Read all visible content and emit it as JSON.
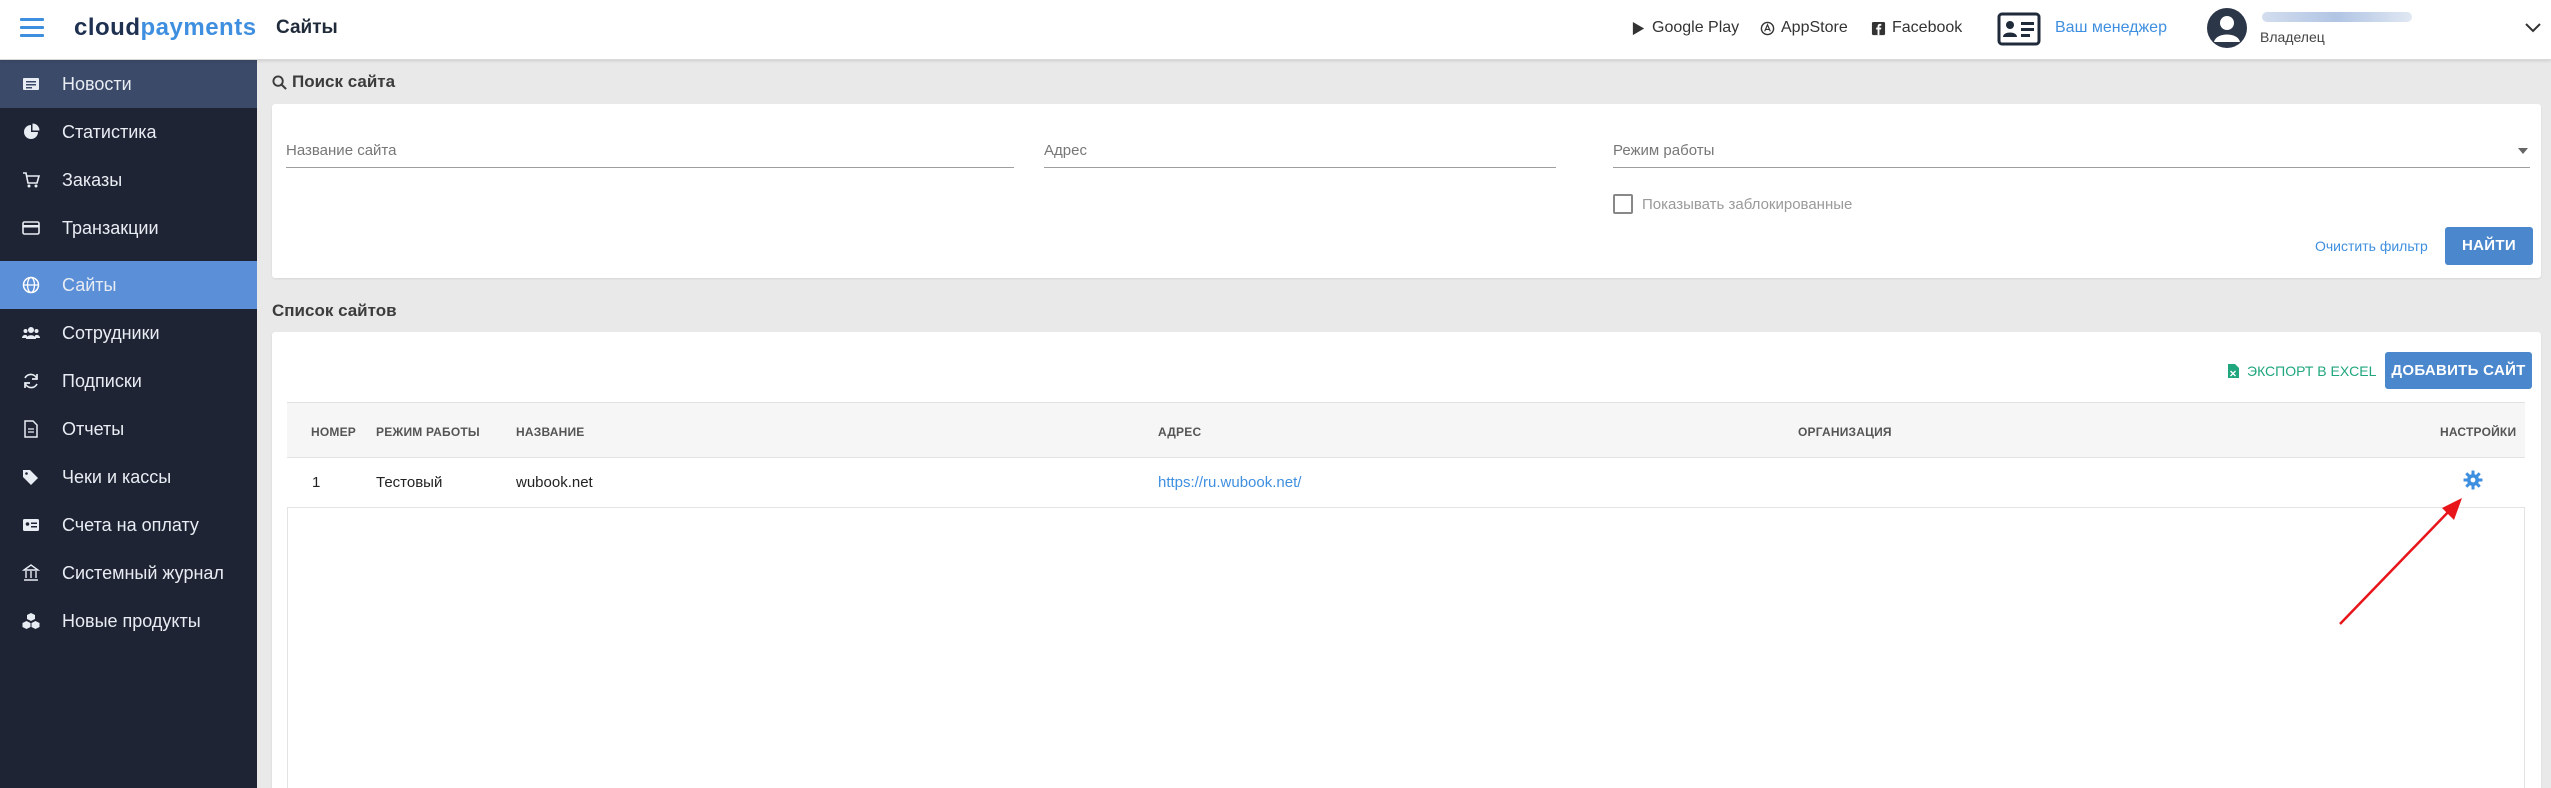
{
  "header": {
    "logo_part1": "cloud",
    "logo_part2": "payments",
    "title": "Сайты",
    "links": {
      "google_play": "Google Play",
      "app_store": "AppStore",
      "facebook": "Facebook"
    },
    "manager": "Ваш менеджер",
    "user_role": "Владелец"
  },
  "sidebar": {
    "items": [
      {
        "label": "Новости",
        "icon": "news-icon"
      },
      {
        "label": "Статистика",
        "icon": "pie-chart-icon"
      },
      {
        "label": "Заказы",
        "icon": "cart-icon"
      },
      {
        "label": "Транзакции",
        "icon": "card-icon"
      },
      {
        "label": "Сайты",
        "icon": "globe-icon"
      },
      {
        "label": "Сотрудники",
        "icon": "users-icon"
      },
      {
        "label": "Подписки",
        "icon": "refresh-icon"
      },
      {
        "label": "Отчеты",
        "icon": "document-icon"
      },
      {
        "label": "Чеки и кассы",
        "icon": "tags-icon"
      },
      {
        "label": "Счета на оплату",
        "icon": "id-card-icon"
      },
      {
        "label": "Системный журнал",
        "icon": "bank-icon"
      },
      {
        "label": "Новые продукты",
        "icon": "cubes-icon"
      }
    ]
  },
  "search": {
    "section_title": "Поиск сайта",
    "name_placeholder": "Название сайта",
    "address_placeholder": "Адрес",
    "mode_placeholder": "Режим работы",
    "show_blocked_label": "Показывать заблокированные",
    "clear_label": "Очистить фильтр",
    "find_label": "НАЙТИ"
  },
  "list": {
    "section_title": "Список сайтов",
    "export_label": "ЭКСПОРТ В EXCEL",
    "add_label": "ДОБАВИТЬ САЙТ",
    "columns": [
      "НОМЕР",
      "РЕЖИМ РАБОТЫ",
      "НАЗВАНИЕ",
      "АДРЕС",
      "ОРГАНИЗАЦИЯ",
      "НАСТРОЙКИ"
    ],
    "rows": [
      {
        "number": "1",
        "mode": "Тестовый",
        "name": "wubook.net",
        "address": "https://ru.wubook.net/",
        "organization": ""
      }
    ]
  },
  "colors": {
    "accent": "#3f8fe0",
    "sidebar_bg": "#1e2434",
    "sidebar_active": "#5b8fd8",
    "button": "#4a87cc",
    "excel_green": "#1fa67c",
    "arrow_red": "#e8151b"
  }
}
